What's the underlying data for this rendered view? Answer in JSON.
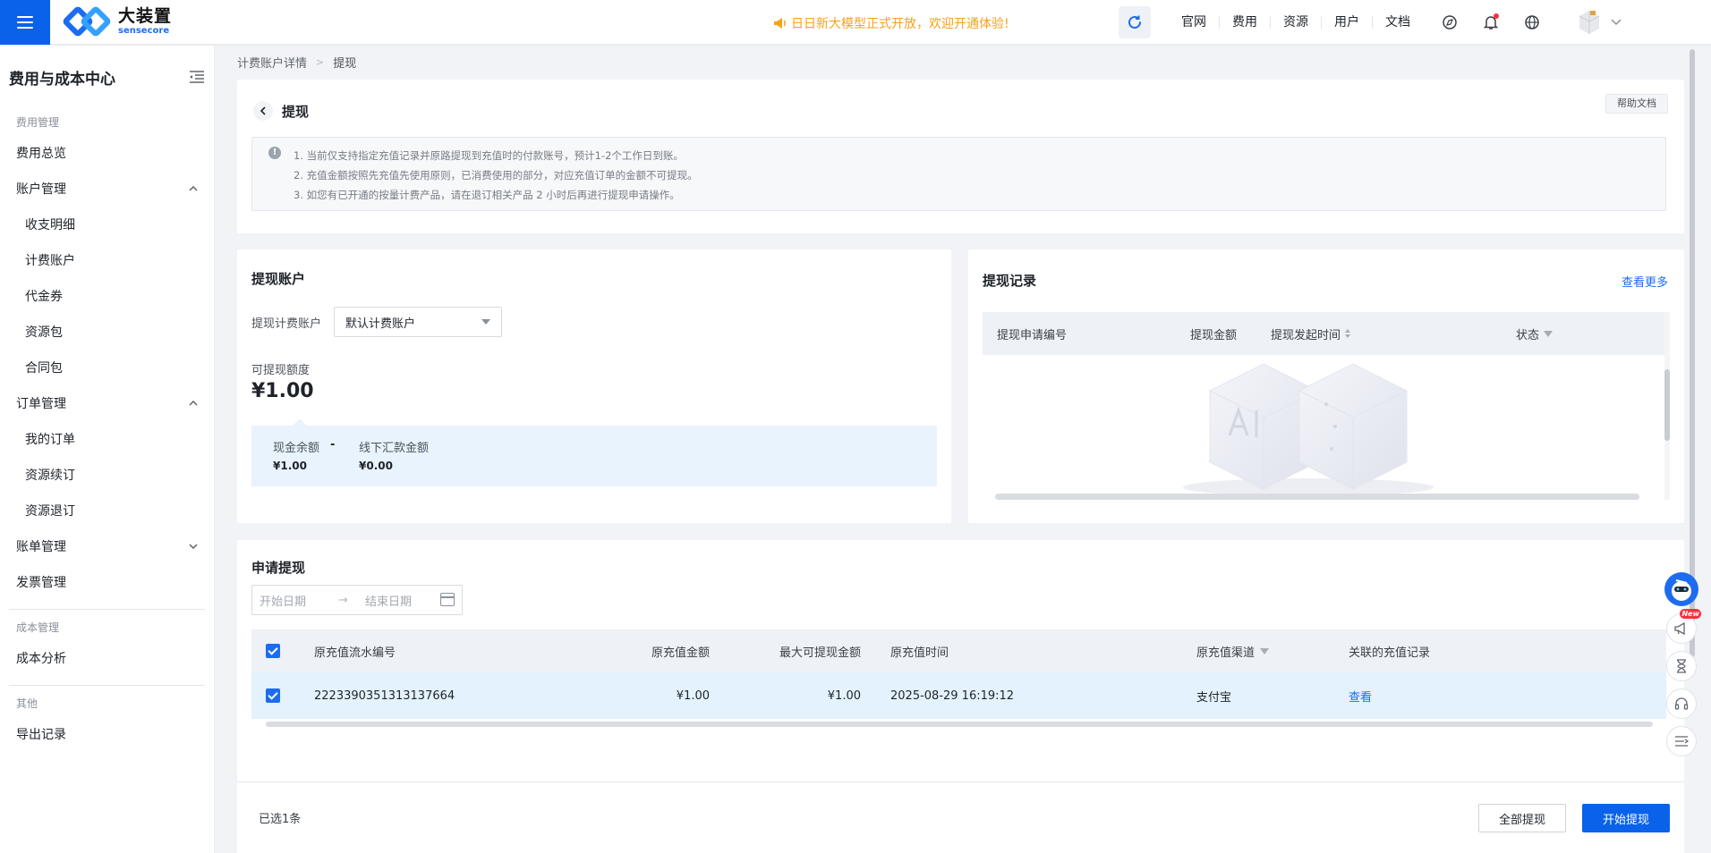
{
  "topbar": {
    "logo_cn": "大装置",
    "logo_en": "sensecore",
    "announcement": "日日新大模型正式开放，欢迎开通体验!",
    "nav": [
      "官网",
      "费用",
      "资源",
      "用户",
      "文档"
    ]
  },
  "sidebar": {
    "title": "费用与成本中心",
    "group_fee": "费用管理",
    "fee_overview": "费用总览",
    "account_mgmt": "账户管理",
    "account_items": [
      "收支明细",
      "计费账户",
      "代金券",
      "资源包",
      "合同包"
    ],
    "order_mgmt": "订单管理",
    "order_items": [
      "我的订单",
      "资源续订",
      "资源退订"
    ],
    "bill_mgmt": "账单管理",
    "invoice_mgmt": "发票管理",
    "group_cost": "成本管理",
    "cost_analysis": "成本分析",
    "group_other": "其他",
    "export_records": "导出记录"
  },
  "breadcrumb": {
    "parent": "计费账户详情",
    "current": "提现"
  },
  "header": {
    "title": "提现",
    "help": "帮助文档",
    "notices": [
      "1. 当前仅支持指定充值记录并原路提现到充值时的付款账号，预计1-2个工作日到账。",
      "2. 充值金额按照先充值先使用原则，已消费使用的部分，对应充值订单的金额不可提现。",
      "3. 如您有已开通的按量计费产品，请在退订相关产品 2 小时后再进行提现申请操作。"
    ]
  },
  "withdraw_account": {
    "title": "提现账户",
    "field_label": "提现计费账户",
    "selected": "默认计费账户",
    "available_label": "可提现额度",
    "available_value": "¥1.00",
    "cash_label": "现金余额",
    "cash_value": "¥1.00",
    "minus": "-",
    "offline_label": "线下汇款金额",
    "offline_value": "¥0.00"
  },
  "records": {
    "title": "提现记录",
    "more": "查看更多",
    "columns": [
      "提现申请编号",
      "提现金额",
      "提现发起时间",
      "状态"
    ]
  },
  "apply": {
    "title": "申请提现",
    "start_placeholder": "开始日期",
    "end_placeholder": "结束日期",
    "columns": [
      "原充值流水编号",
      "原充值金额",
      "最大可提现金额",
      "原充值时间",
      "原充值渠道",
      "关联的充值记录"
    ],
    "rows": [
      {
        "serial": "2223390351313137664",
        "amount": "¥1.00",
        "max": "¥1.00",
        "time": "2025-08-29 16:19:12",
        "channel": "支付宝",
        "action": "查看"
      }
    ]
  },
  "footer": {
    "selected": "已选1条",
    "withdraw_all": "全部提现",
    "start_withdraw": "开始提现"
  },
  "float": {
    "new_badge": "New"
  },
  "colors": {
    "primary": "#0a62ea",
    "link": "#1d6cf0",
    "announce": "#f6a21a"
  }
}
